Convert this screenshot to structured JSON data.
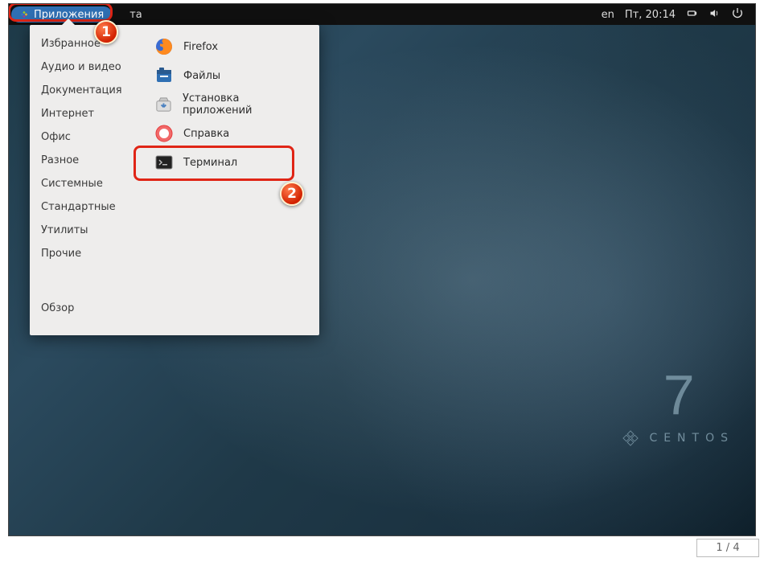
{
  "topbar": {
    "applications_label": "Приложения",
    "places_label": "та",
    "lang": "en",
    "clock": "Пт, 20:14"
  },
  "menu": {
    "categories": [
      "Избранное",
      "Аудио и видео",
      "Документация",
      "Интернет",
      "Офис",
      "Разное",
      "Системные",
      "Стандартные",
      "Утилиты",
      "Прочие"
    ],
    "overview": "Обзор",
    "apps": [
      {
        "icon": "firefox",
        "name": "Firefox"
      },
      {
        "icon": "files",
        "name": "Файлы"
      },
      {
        "icon": "software",
        "name": "Установка приложений"
      },
      {
        "icon": "help",
        "name": "Справка"
      },
      {
        "icon": "terminal",
        "name": "Терминал"
      }
    ]
  },
  "brand": {
    "version": "7",
    "name": "CENTOS"
  },
  "annotations": {
    "marker1": "1",
    "marker2": "2"
  },
  "footer": {
    "page": "1 / 4"
  }
}
